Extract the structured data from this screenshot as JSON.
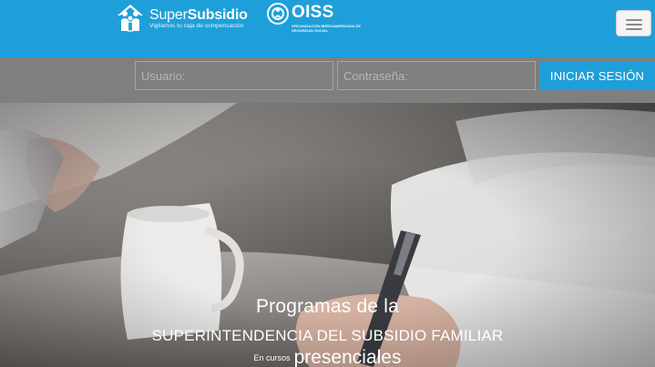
{
  "header": {
    "brand_name_light": "Super",
    "brand_name_bold": "Subsidio",
    "brand_tagline": "Vigilamos tu caja de compensación",
    "partner_name": "OISS",
    "partner_subtitle": "ORGANIZACIÓN IBEROAMERICANA DE SEGURIDAD SOCIAL",
    "menu_icon": "hamburger-icon",
    "color_primary": "#1f9fd9"
  },
  "login": {
    "username_placeholder": "Usuario:",
    "password_placeholder": "Contraseña:",
    "submit_label": "INICIAR SESIÓN",
    "bar_color": "#7f7f7f"
  },
  "hero": {
    "line1": "Programas de la",
    "line2": "SUPERINTENDENCIA DEL SUBSIDIO FAMILIAR",
    "line3_small": "En cursos",
    "line3_big": "presenciales",
    "image": "hands-writing-with-pen-on-paper"
  }
}
